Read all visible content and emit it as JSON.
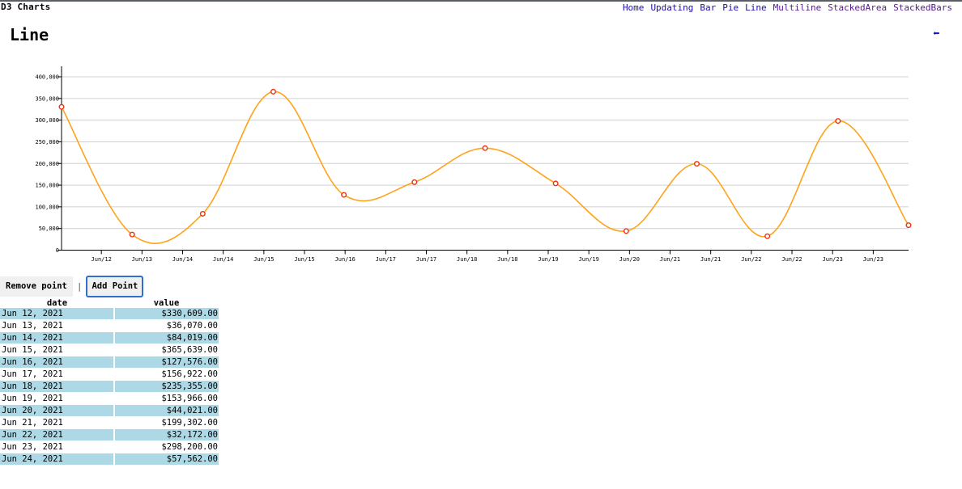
{
  "header": {
    "brand": "D3 Charts",
    "nav": [
      {
        "label": "Home",
        "visited": false
      },
      {
        "label": "Updating",
        "visited": false
      },
      {
        "label": "Bar",
        "visited": false
      },
      {
        "label": "Pie",
        "visited": false
      },
      {
        "label": "Line",
        "visited": false
      },
      {
        "label": "Multiline",
        "visited": true
      },
      {
        "label": "StackedArea",
        "visited": true
      },
      {
        "label": "StackedBars",
        "visited": true
      }
    ]
  },
  "page": {
    "title": "Line",
    "back_icon": "left-arrow-icon"
  },
  "controls": {
    "remove_label": "Remove point",
    "separator": "|",
    "add_label": "Add Point"
  },
  "table": {
    "headers": [
      "date",
      "value"
    ],
    "rows": [
      {
        "date": "Jun 12, 2021",
        "value": "$330,609.00",
        "highlight": true
      },
      {
        "date": "Jun 13, 2021",
        "value": "$36,070.00",
        "highlight": false
      },
      {
        "date": "Jun 14, 2021",
        "value": "$84,019.00",
        "highlight": true
      },
      {
        "date": "Jun 15, 2021",
        "value": "$365,639.00",
        "highlight": false
      },
      {
        "date": "Jun 16, 2021",
        "value": "$127,576.00",
        "highlight": true
      },
      {
        "date": "Jun 17, 2021",
        "value": "$156,922.00",
        "highlight": false
      },
      {
        "date": "Jun 18, 2021",
        "value": "$235,355.00",
        "highlight": true
      },
      {
        "date": "Jun 19, 2021",
        "value": "$153,966.00",
        "highlight": false
      },
      {
        "date": "Jun 20, 2021",
        "value": "$44,021.00",
        "highlight": true
      },
      {
        "date": "Jun 21, 2021",
        "value": "$199,302.00",
        "highlight": false
      },
      {
        "date": "Jun 22, 2021",
        "value": "$32,172.00",
        "highlight": true
      },
      {
        "date": "Jun 23, 2021",
        "value": "$298,200.00",
        "highlight": false
      },
      {
        "date": "Jun 24, 2021",
        "value": "$57,562.00",
        "highlight": true
      }
    ]
  },
  "chart_data": {
    "type": "line",
    "x": [
      "2021-06-12",
      "2021-06-13",
      "2021-06-14",
      "2021-06-15",
      "2021-06-16",
      "2021-06-17",
      "2021-06-18",
      "2021-06-19",
      "2021-06-20",
      "2021-06-21",
      "2021-06-22",
      "2021-06-23",
      "2021-06-24"
    ],
    "values": [
      330609,
      36070,
      84019,
      365639,
      127576,
      156922,
      235355,
      153966,
      44021,
      199302,
      32172,
      298200,
      57562
    ],
    "y_ticks": [
      "0",
      "50,000",
      "100,000",
      "150,000",
      "200,000",
      "250,000",
      "300,000",
      "350,000",
      "400,000"
    ],
    "x_ticks": [
      "Jun/12",
      "Jun/13",
      "Jun/14",
      "Jun/14",
      "Jun/15",
      "Jun/15",
      "Jun/16",
      "Jun/17",
      "Jun/17",
      "Jun/18",
      "Jun/18",
      "Jun/19",
      "Jun/19",
      "Jun/20",
      "Jun/21",
      "Jun/21",
      "Jun/22",
      "Jun/22",
      "Jun/23",
      "Jun/23"
    ],
    "ylim": [
      0,
      400000
    ],
    "grid": true,
    "line_color": "#ffa31a",
    "point_color": "#ee3311"
  }
}
